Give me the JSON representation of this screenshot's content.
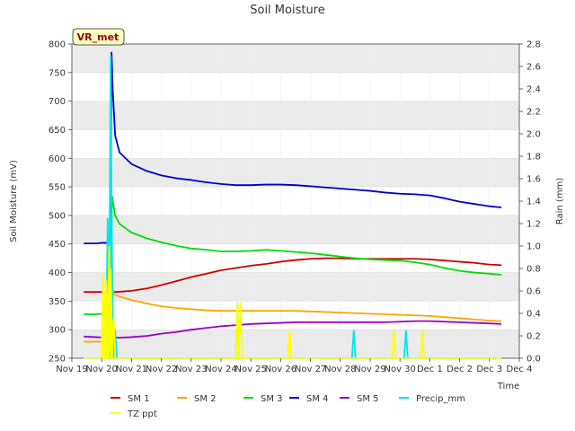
{
  "chart_data": {
    "type": "line",
    "title": "Soil Moisture",
    "badge": "VR_met",
    "xlabel": "Time",
    "ylabel_left": "Soil Moisture (mV)",
    "ylabel_right": "Rain (mm)",
    "x_ticks": [
      "Nov 19",
      "Nov 20",
      "Nov 21",
      "Nov 22",
      "Nov 23",
      "Nov 24",
      "Nov 25",
      "Nov 26",
      "Nov 27",
      "Nov 28",
      "Nov 29",
      "Nov 30",
      "Dec 1",
      "Dec 2",
      "Dec 3",
      "Dec 4"
    ],
    "x_range_days": [
      0,
      15
    ],
    "ylim_left": [
      250,
      800
    ],
    "ylim_right": [
      0,
      2.8
    ],
    "y_ticks_left": [
      250,
      300,
      350,
      400,
      450,
      500,
      550,
      600,
      650,
      700,
      750,
      800
    ],
    "y_ticks_right": [
      0.0,
      0.2,
      0.4,
      0.6,
      0.8,
      1.0,
      1.2,
      1.4,
      1.6,
      1.8,
      2.0,
      2.2,
      2.4,
      2.6,
      2.8
    ],
    "band_color": "#ebebeb",
    "series": [
      {
        "name": "SM 1",
        "axis": "left",
        "color": "#cc0000",
        "x": [
          0.4,
          1.0,
          1.5,
          2.0,
          2.5,
          3.0,
          3.5,
          4.0,
          4.5,
          5.0,
          5.5,
          6.0,
          6.5,
          7.0,
          7.5,
          8.0,
          8.5,
          9.0,
          9.5,
          10.0,
          10.5,
          11.0,
          11.5,
          12.0,
          12.5,
          13.0,
          13.5,
          14.0,
          14.4
        ],
        "values": [
          366,
          366,
          366,
          368,
          372,
          378,
          385,
          392,
          398,
          404,
          408,
          412,
          415,
          419,
          422,
          424,
          425,
          425,
          424,
          424,
          424,
          424,
          424,
          423,
          421,
          419,
          417,
          414,
          413
        ]
      },
      {
        "name": "SM 2",
        "axis": "left",
        "color": "#ffa500",
        "x": [
          0.4,
          0.8,
          1.2,
          1.3,
          1.4,
          1.6,
          2.0,
          2.5,
          3.0,
          3.5,
          4.0,
          4.5,
          5.0,
          5.5,
          6.0,
          6.5,
          7.0,
          7.5,
          8.0,
          8.5,
          9.0,
          9.5,
          10.0,
          10.5,
          11.0,
          11.5,
          12.0,
          12.5,
          13.0,
          13.5,
          14.0,
          14.4
        ],
        "values": [
          279,
          279,
          279,
          400,
          362,
          358,
          352,
          346,
          341,
          338,
          336,
          334,
          333,
          333,
          333,
          333,
          333,
          333,
          332,
          331,
          330,
          329,
          328,
          327,
          326,
          325,
          324,
          322,
          320,
          318,
          316,
          315
        ]
      },
      {
        "name": "SM 3",
        "axis": "left",
        "color": "#00dd00",
        "x": [
          0.4,
          0.8,
          1.0,
          1.2,
          1.3,
          1.35,
          1.45,
          1.6,
          2.0,
          2.5,
          3.0,
          3.5,
          4.0,
          4.5,
          5.0,
          5.5,
          6.0,
          6.5,
          7.0,
          7.5,
          8.0,
          8.5,
          9.0,
          9.5,
          10.0,
          10.5,
          11.0,
          11.5,
          12.0,
          12.5,
          13.0,
          13.5,
          14.0,
          14.4
        ],
        "values": [
          327,
          327,
          328,
          330,
          400,
          533,
          500,
          485,
          470,
          460,
          453,
          447,
          442,
          440,
          437,
          437,
          438,
          440,
          438,
          436,
          434,
          431,
          428,
          425,
          423,
          422,
          421,
          418,
          414,
          408,
          403,
          400,
          398,
          396
        ]
      },
      {
        "name": "SM 4",
        "axis": "left",
        "color": "#0000cc",
        "x": [
          0.4,
          0.8,
          1.0,
          1.2,
          1.3,
          1.33,
          1.37,
          1.45,
          1.6,
          1.8,
          2.0,
          2.5,
          3.0,
          3.5,
          4.0,
          4.5,
          5.0,
          5.5,
          6.0,
          6.5,
          7.0,
          7.5,
          8.0,
          8.5,
          9.0,
          9.5,
          10.0,
          10.5,
          11.0,
          11.5,
          12.0,
          12.5,
          13.0,
          13.5,
          14.0,
          14.4
        ],
        "values": [
          451,
          451,
          452,
          452,
          460,
          785,
          720,
          640,
          610,
          600,
          590,
          578,
          570,
          565,
          562,
          558,
          555,
          553,
          553,
          554,
          554,
          553,
          551,
          549,
          547,
          545,
          543,
          540,
          538,
          537,
          535,
          530,
          524,
          520,
          516,
          514
        ]
      },
      {
        "name": "SM 5",
        "axis": "left",
        "color": "#9900cc",
        "x": [
          0.4,
          0.8,
          1.2,
          1.6,
          2.0,
          2.5,
          3.0,
          3.5,
          4.0,
          4.5,
          5.0,
          5.5,
          6.0,
          6.5,
          7.0,
          7.5,
          8.0,
          8.5,
          9.0,
          9.5,
          10.0,
          10.5,
          11.0,
          11.5,
          12.0,
          12.5,
          13.0,
          13.5,
          14.0,
          14.4
        ],
        "values": [
          288,
          287,
          286,
          286,
          287,
          289,
          293,
          296,
          300,
          303,
          306,
          308,
          310,
          311,
          312,
          313,
          313,
          313,
          313,
          313,
          313,
          313,
          314,
          315,
          315,
          314,
          313,
          312,
          311,
          310
        ]
      },
      {
        "name": "Precip_mm",
        "axis": "right",
        "color": "#00e5ee",
        "type": "spikes",
        "x": [
          1.2,
          1.3,
          1.33,
          1.45,
          5.55,
          9.45,
          11.2
        ],
        "values": [
          1.25,
          2.7,
          1.3,
          0.25,
          0.5,
          0.25,
          0.25
        ]
      },
      {
        "name": "TZ ppt",
        "axis": "right",
        "color": "#ffff00",
        "type": "spikes",
        "x": [
          1.05,
          1.1,
          1.15,
          1.25,
          1.3,
          1.4,
          5.55,
          5.65,
          7.3,
          10.8,
          11.75
        ],
        "values": [
          0.75,
          0.6,
          0.7,
          1.0,
          0.8,
          0.35,
          0.5,
          0.5,
          0.25,
          0.25,
          0.25
        ]
      }
    ],
    "legend_placement": "bottom"
  }
}
